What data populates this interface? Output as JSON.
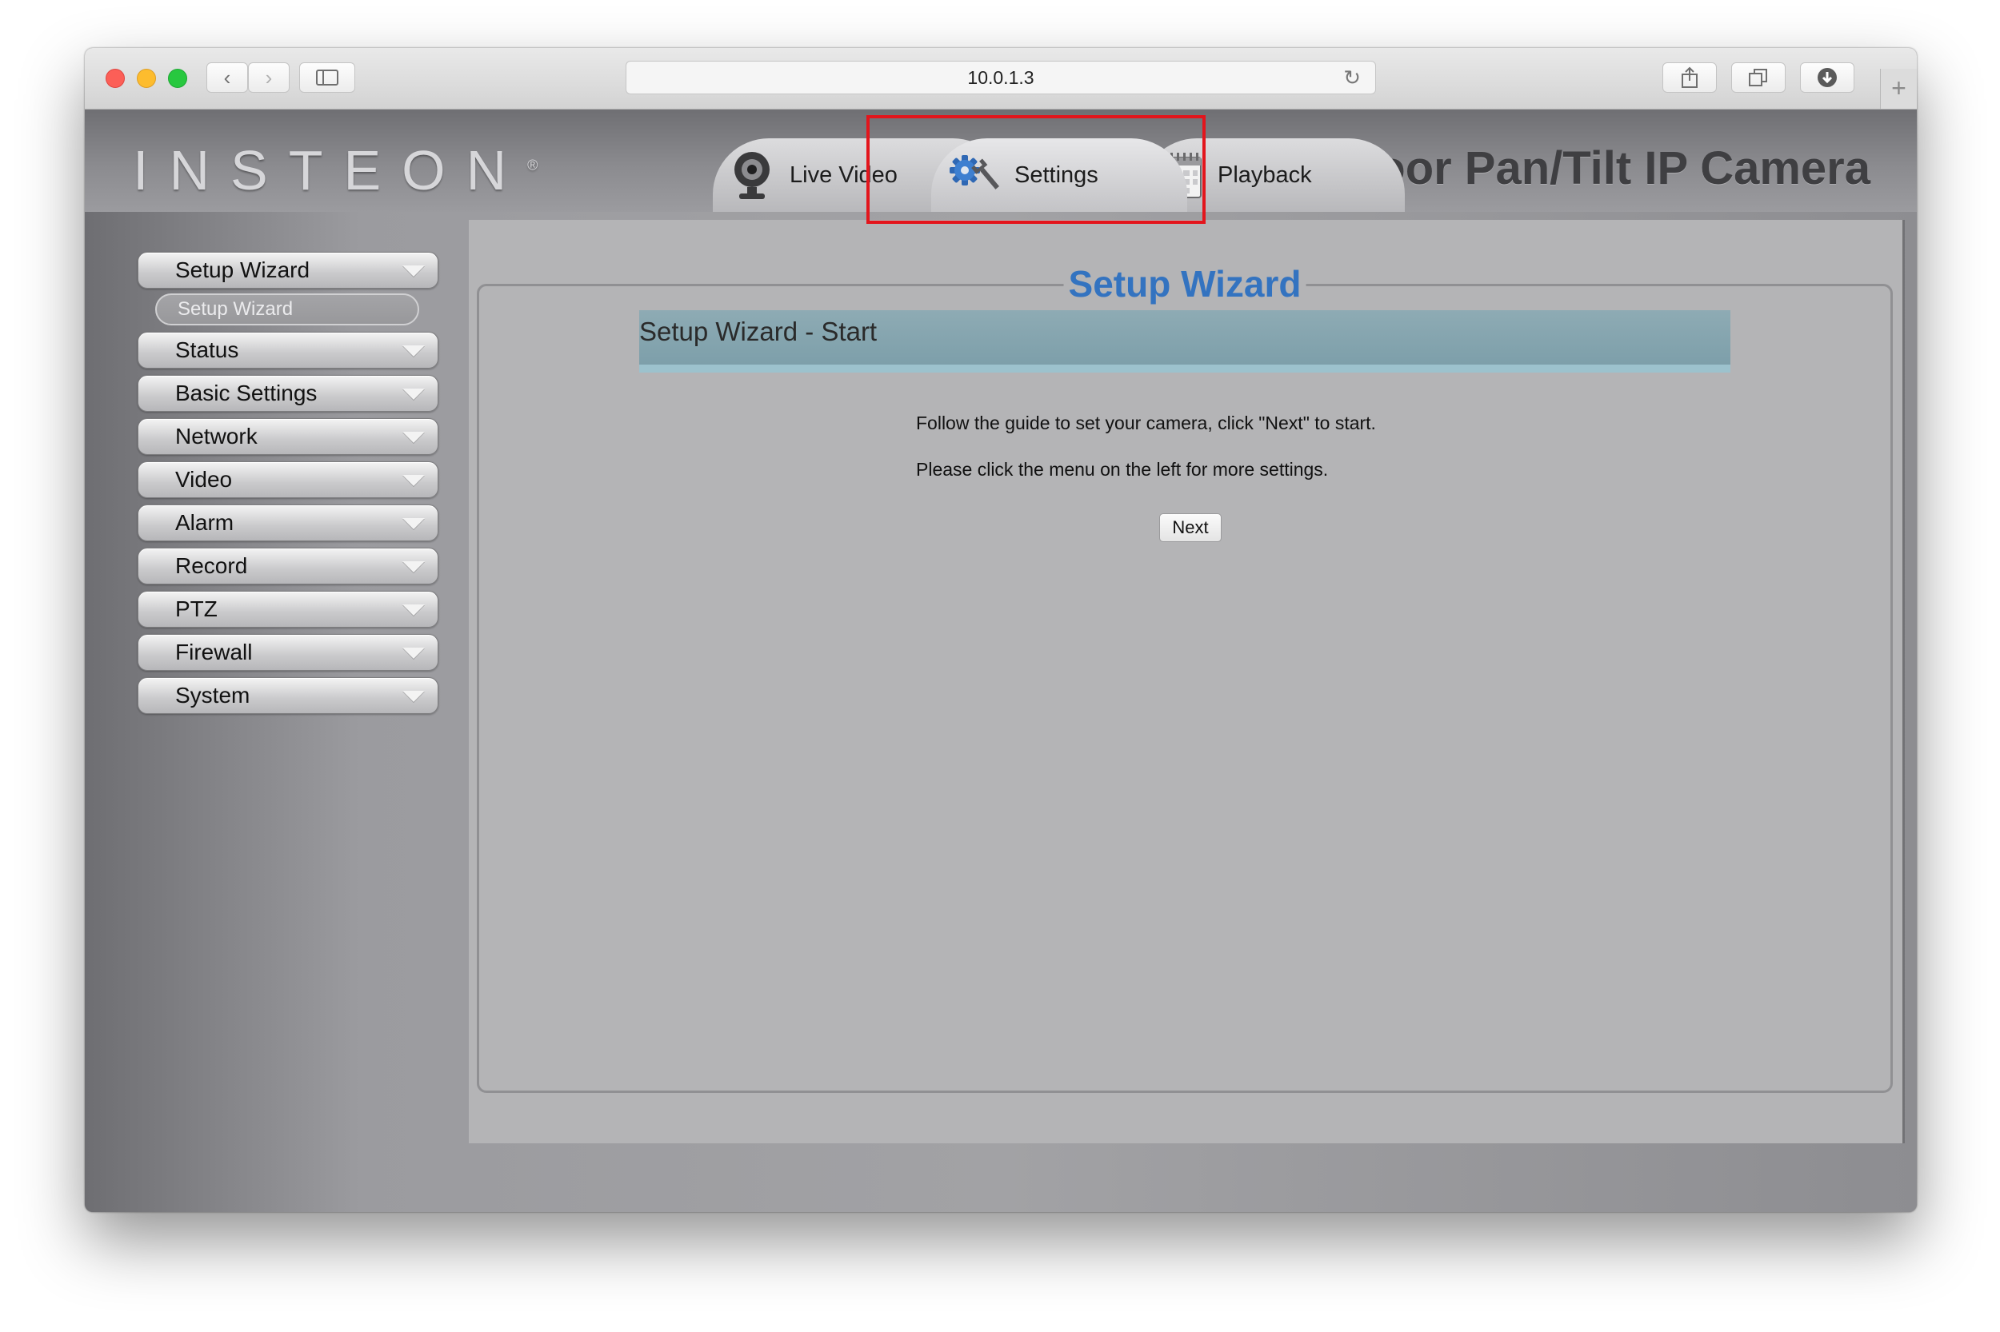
{
  "browser": {
    "url": "10.0.1.3",
    "icons": {
      "back": "chevron-left-icon",
      "forward": "chevron-right-icon",
      "sidebar": "sidebar-icon",
      "reload": "reload-icon",
      "share": "share-icon",
      "tabs": "tabs-icon",
      "downloads": "download-icon",
      "new_tab": "plus-icon"
    },
    "glyphs": {
      "back": "‹",
      "forward": "›",
      "reload": "↻",
      "new_tab": "+"
    }
  },
  "header": {
    "logo": "INSTEON",
    "logo_mark": "®",
    "product_title": "Indoor Pan/Tilt IP Camera",
    "tabs": [
      {
        "label": "Live Video",
        "icon": "webcam-icon"
      },
      {
        "label": "Settings",
        "icon": "gears-icon",
        "active": true
      },
      {
        "label": "Playback",
        "icon": "calendar-icon"
      }
    ]
  },
  "sidebar": {
    "items": [
      {
        "label": "Setup Wizard",
        "expanded": true,
        "sub_items": [
          "Setup Wizard"
        ]
      },
      {
        "label": "Status"
      },
      {
        "label": "Basic Settings"
      },
      {
        "label": "Network"
      },
      {
        "label": "Video"
      },
      {
        "label": "Alarm"
      },
      {
        "label": "Record"
      },
      {
        "label": "PTZ"
      },
      {
        "label": "Firewall"
      },
      {
        "label": "System"
      }
    ]
  },
  "main": {
    "title": "Setup Wizard",
    "section_title": "Setup Wizard - Start",
    "instructions": [
      "Follow the guide to set your camera, click \"Next\" to start.",
      "Please click the menu on the left for more settings."
    ],
    "next_label": "Next"
  },
  "colors": {
    "title_blue": "#3373c0",
    "highlight_red": "#e3151c",
    "banner": "#7d9faa"
  }
}
